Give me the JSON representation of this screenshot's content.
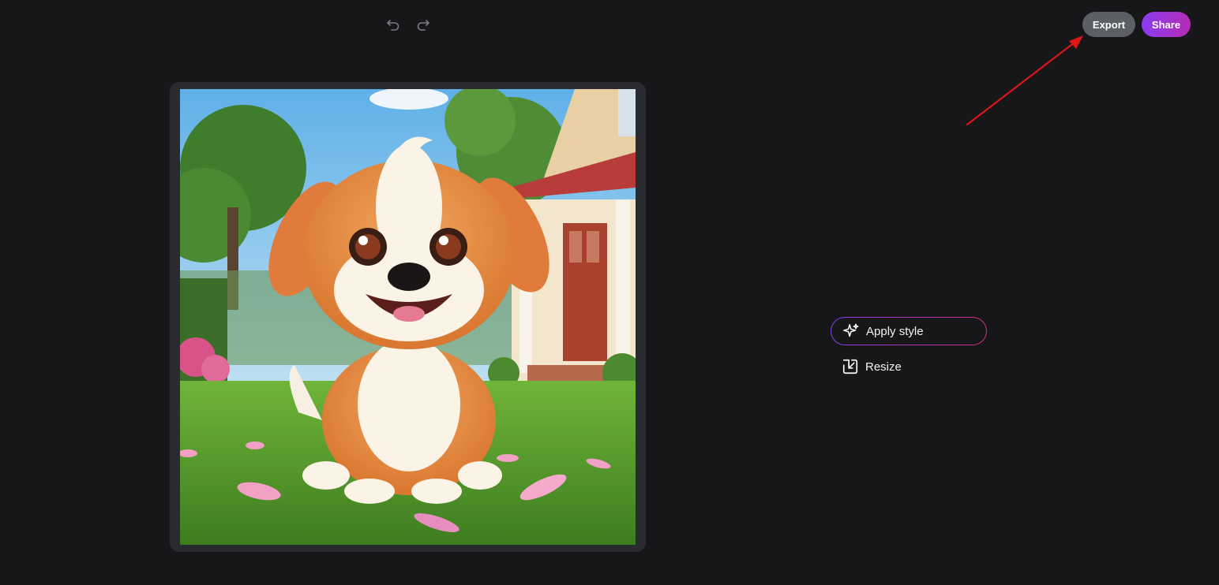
{
  "toolbar": {
    "undo_icon": "undo-icon",
    "redo_icon": "redo-icon",
    "export_label": "Export",
    "share_label": "Share"
  },
  "canvas": {
    "image_subject": "cartoon puppy sitting on lawn"
  },
  "side_menu": {
    "items": [
      {
        "label": "Apply style",
        "icon": "sparkles-icon",
        "active": true
      },
      {
        "label": "Resize",
        "icon": "resize-icon",
        "active": false
      }
    ]
  },
  "colors": {
    "background": "#17171a",
    "export_button": "#5c5f66",
    "share_gradient_start": "#8a3cf0",
    "share_gradient_end": "#b62bb5",
    "annotation_arrow": "#e01515"
  }
}
